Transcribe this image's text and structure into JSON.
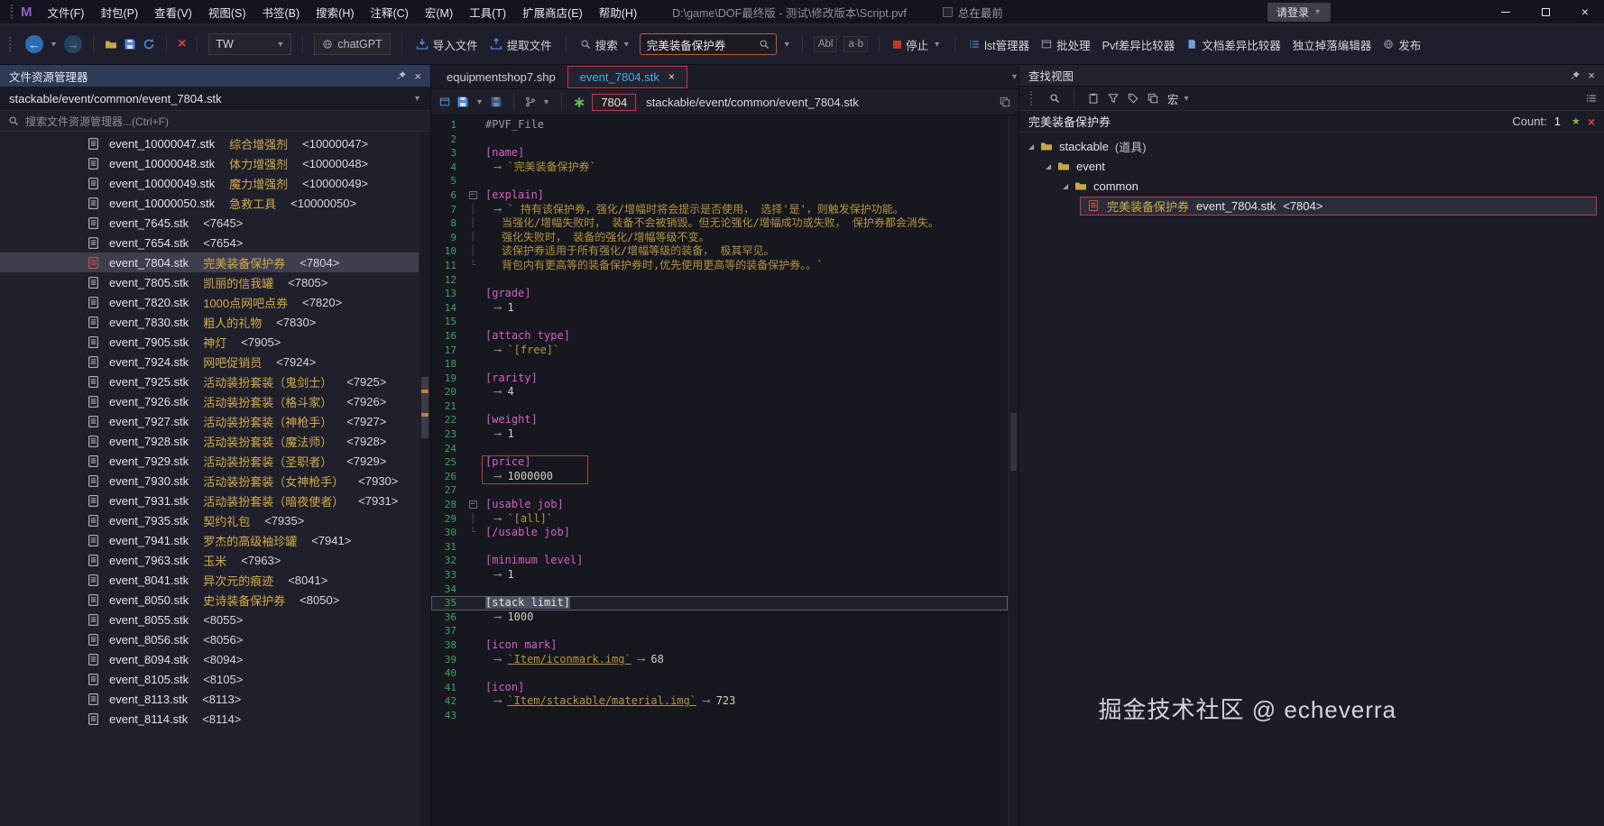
{
  "icons": {
    "back": "←",
    "forward": "→",
    "close": "×",
    "dropdown": "▾",
    "star": "∗",
    "sparkle": "★",
    "expand": "◢",
    "fold_collapse": "−",
    "guide_mid": "│",
    "guide_end": "└"
  },
  "titlebar": {
    "logo": "M",
    "menus": [
      "文件(F)",
      "封包(P)",
      "查看(V)",
      "视图(S)",
      "书签(B)",
      "搜索(H)",
      "注释(C)",
      "宏(M)",
      "工具(T)",
      "扩展商店(E)",
      "帮助(H)"
    ],
    "file_path": "D:\\game\\DOF最终版 - 测试\\修改版本\\Script.pvf",
    "always_on_top": "总在最前",
    "login": "请登录"
  },
  "toolbar": {
    "language": "TW",
    "chatgpt": "chatGPT",
    "import_file": "导入文件",
    "extract_file": "提取文件",
    "search_menu": "搜索",
    "search_value": "完美装备保护券",
    "match_case": "Abl",
    "match_word": "a·b",
    "stop": "停止",
    "lst_manager": "lst管理器",
    "batch": "批处理",
    "pvf_diff": "Pvf差异比较器",
    "doc_diff": "文档差异比较器",
    "drop_editor": "独立掉落编辑器",
    "publish": "发布"
  },
  "explorer": {
    "title": "文件资源管理器",
    "path": "stackable/event/common/event_7804.stk",
    "search_placeholder": "搜索文件资源管理器...(Ctrl+F)",
    "files": [
      {
        "name": "event_10000047.stk",
        "desc": "综合增强剂",
        "id": "<10000047>"
      },
      {
        "name": "event_10000048.stk",
        "desc": "体力增强剂",
        "id": "<10000048>"
      },
      {
        "name": "event_10000049.stk",
        "desc": "魔力增强剂",
        "id": "<10000049>"
      },
      {
        "name": "event_10000050.stk",
        "desc": "急救工具",
        "id": "<10000050>"
      },
      {
        "name": "event_7645.stk",
        "desc": "",
        "id": "<7645>"
      },
      {
        "name": "event_7654.stk",
        "desc": "",
        "id": "<7654>"
      },
      {
        "name": "event_7804.stk",
        "desc": "完美装备保护券",
        "id": "<7804>",
        "selected": true
      },
      {
        "name": "event_7805.stk",
        "desc": "凯丽的信我罐",
        "id": "<7805>"
      },
      {
        "name": "event_7820.stk",
        "desc": "1000点网吧点券",
        "id": "<7820>"
      },
      {
        "name": "event_7830.stk",
        "desc": "粗人的礼物",
        "id": "<7830>"
      },
      {
        "name": "event_7905.stk",
        "desc": "神灯",
        "id": "<7905>"
      },
      {
        "name": "event_7924.stk",
        "desc": "网吧促销员",
        "id": "<7924>"
      },
      {
        "name": "event_7925.stk",
        "desc": "活动装扮套装（鬼剑士）",
        "id": "<7925>"
      },
      {
        "name": "event_7926.stk",
        "desc": "活动装扮套装（格斗家）",
        "id": "<7926>"
      },
      {
        "name": "event_7927.stk",
        "desc": "活动装扮套装（神枪手）",
        "id": "<7927>"
      },
      {
        "name": "event_7928.stk",
        "desc": "活动装扮套装（魔法师）",
        "id": "<7928>"
      },
      {
        "name": "event_7929.stk",
        "desc": "活动装扮套装（圣职者）",
        "id": "<7929>"
      },
      {
        "name": "event_7930.stk",
        "desc": "活动装扮套装（女神枪手）",
        "id": "<7930>"
      },
      {
        "name": "event_7931.stk",
        "desc": "活动装扮套装（暗夜使者）",
        "id": "<7931>"
      },
      {
        "name": "event_7935.stk",
        "desc": "契约礼包",
        "id": "<7935>"
      },
      {
        "name": "event_7941.stk",
        "desc": "罗杰的高级袖珍罐",
        "id": "<7941>"
      },
      {
        "name": "event_7963.stk",
        "desc": "玉米",
        "id": "<7963>"
      },
      {
        "name": "event_8041.stk",
        "desc": "异次元的痕迹",
        "id": "<8041>"
      },
      {
        "name": "event_8050.stk",
        "desc": "史诗装备保护券",
        "id": "<8050>"
      },
      {
        "name": "event_8055.stk",
        "desc": "",
        "id": "<8055>"
      },
      {
        "name": "event_8056.stk",
        "desc": "",
        "id": "<8056>"
      },
      {
        "name": "event_8094.stk",
        "desc": "",
        "id": "<8094>"
      },
      {
        "name": "event_8105.stk",
        "desc": "",
        "id": "<8105>"
      },
      {
        "name": "event_8113.stk",
        "desc": "",
        "id": "<8113>"
      },
      {
        "name": "event_8114.stk",
        "desc": "",
        "id": "<8114>"
      }
    ]
  },
  "editor": {
    "tabs": [
      {
        "label": "equipmentshop7.shp",
        "active": false
      },
      {
        "label": "event_7804.stk",
        "active": true
      }
    ],
    "locate_id": "7804",
    "path": "stackable/event/common/event_7804.stk",
    "lines": [
      {
        "n": 1,
        "segs": [
          {
            "c": "cmt",
            "t": "#PVF_File"
          }
        ]
      },
      {
        "n": 2,
        "segs": []
      },
      {
        "n": 3,
        "segs": [
          {
            "c": "tag",
            "t": "[name]"
          }
        ]
      },
      {
        "n": 4,
        "ind": 1,
        "segs": [
          {
            "c": "arr",
            "t": "⟶ "
          },
          {
            "c": "str",
            "t": "`完美装备保护券`"
          }
        ]
      },
      {
        "n": 5,
        "segs": []
      },
      {
        "n": 6,
        "fold": true,
        "segs": [
          {
            "c": "tag",
            "t": "[explain]"
          }
        ]
      },
      {
        "n": 7,
        "guide": "mid",
        "ind": 1,
        "segs": [
          {
            "c": "arr",
            "t": "⟶ "
          },
          {
            "c": "str",
            "t": "` 持有该保护券，强化/增幅时将会提示是否使用， 选择'是'，则触发保护功能。"
          }
        ]
      },
      {
        "n": 8,
        "guide": "mid",
        "ind": 2,
        "segs": [
          {
            "c": "str",
            "t": "当强化/增幅失败时， 装备不会被销毁。但无论强化/增幅成功或失败， 保护券都会消失。"
          }
        ]
      },
      {
        "n": 9,
        "guide": "mid",
        "ind": 2,
        "segs": [
          {
            "c": "str",
            "t": "强化失败时， 装备的强化/增幅等级不变。"
          }
        ]
      },
      {
        "n": 10,
        "guide": "mid",
        "ind": 2,
        "segs": [
          {
            "c": "str",
            "t": "该保护券适用于所有强化/增幅等级的装备， 极其罕见。"
          }
        ]
      },
      {
        "n": 11,
        "guide": "end",
        "ind": 2,
        "segs": [
          {
            "c": "str",
            "t": "背包内有更高等的装备保护券时,优先使用更高等的装备保护券。。`"
          }
        ]
      },
      {
        "n": 12,
        "segs": []
      },
      {
        "n": 13,
        "segs": [
          {
            "c": "tag",
            "t": "[grade]"
          }
        ]
      },
      {
        "n": 14,
        "ind": 1,
        "segs": [
          {
            "c": "arr",
            "t": "⟶ "
          },
          {
            "c": "num",
            "t": "1"
          }
        ]
      },
      {
        "n": 15,
        "segs": []
      },
      {
        "n": 16,
        "segs": [
          {
            "c": "tag",
            "t": "[attach type]"
          }
        ]
      },
      {
        "n": 17,
        "ind": 1,
        "segs": [
          {
            "c": "arr",
            "t": "⟶ "
          },
          {
            "c": "str",
            "t": "`[free]`"
          }
        ]
      },
      {
        "n": 18,
        "segs": []
      },
      {
        "n": 19,
        "segs": [
          {
            "c": "tag",
            "t": "[rarity]"
          }
        ]
      },
      {
        "n": 20,
        "ind": 1,
        "segs": [
          {
            "c": "arr",
            "t": "⟶ "
          },
          {
            "c": "num",
            "t": "4"
          }
        ]
      },
      {
        "n": 21,
        "segs": []
      },
      {
        "n": 22,
        "segs": [
          {
            "c": "tag",
            "t": "[weight]"
          }
        ]
      },
      {
        "n": 23,
        "ind": 1,
        "segs": [
          {
            "c": "arr",
            "t": "⟶ "
          },
          {
            "c": "num",
            "t": "1"
          }
        ]
      },
      {
        "n": 24,
        "segs": []
      },
      {
        "n": 25,
        "segs": [
          {
            "c": "tag",
            "t": "[price]"
          }
        ]
      },
      {
        "n": 26,
        "ind": 1,
        "segs": [
          {
            "c": "arr",
            "t": "⟶ "
          },
          {
            "c": "num",
            "t": "1000000"
          }
        ]
      },
      {
        "n": 27,
        "segs": []
      },
      {
        "n": 28,
        "fold": true,
        "segs": [
          {
            "c": "tag",
            "t": "[usable job]"
          }
        ]
      },
      {
        "n": 29,
        "guide": "mid",
        "ind": 1,
        "segs": [
          {
            "c": "arr",
            "t": "⟶ "
          },
          {
            "c": "str",
            "t": "`[all]`"
          }
        ]
      },
      {
        "n": 30,
        "guide": "end",
        "segs": [
          {
            "c": "tag",
            "t": "[/usable job]"
          }
        ]
      },
      {
        "n": 31,
        "segs": []
      },
      {
        "n": 32,
        "segs": [
          {
            "c": "tag",
            "t": "[minimum level]"
          }
        ]
      },
      {
        "n": 33,
        "ind": 1,
        "segs": [
          {
            "c": "arr",
            "t": "⟶ "
          },
          {
            "c": "num",
            "t": "1"
          }
        ]
      },
      {
        "n": 34,
        "segs": []
      },
      {
        "n": 35,
        "current": true,
        "segs": [
          {
            "c": "tag",
            "t": "[stack limit]",
            "sel": true
          }
        ]
      },
      {
        "n": 36,
        "ind": 1,
        "segs": [
          {
            "c": "arr",
            "t": "⟶ "
          },
          {
            "c": "num",
            "t": "1000"
          }
        ]
      },
      {
        "n": 37,
        "segs": []
      },
      {
        "n": 38,
        "segs": [
          {
            "c": "tag",
            "t": "[icon mark]"
          }
        ]
      },
      {
        "n": 39,
        "ind": 1,
        "segs": [
          {
            "c": "arr",
            "t": "⟶ "
          },
          {
            "c": "link",
            "t": "`Item/iconmark.img`"
          },
          {
            "c": "arr",
            "t": " ⟶ "
          },
          {
            "c": "num",
            "t": "68"
          }
        ]
      },
      {
        "n": 40,
        "segs": []
      },
      {
        "n": 41,
        "segs": [
          {
            "c": "tag",
            "t": "[icon]"
          }
        ]
      },
      {
        "n": 42,
        "ind": 1,
        "segs": [
          {
            "c": "arr",
            "t": "⟶ "
          },
          {
            "c": "link",
            "t": "`Item/stackable/material.img`"
          },
          {
            "c": "arr",
            "t": " ⟶ "
          },
          {
            "c": "num",
            "t": "723"
          }
        ]
      },
      {
        "n": 43,
        "segs": []
      }
    ]
  },
  "find_view": {
    "title": "查找视图",
    "macro": "宏",
    "query": "完美装备保护券",
    "count_label": "Count:",
    "count_value": "1",
    "tree": [
      {
        "level": 0,
        "folder": true,
        "label": "stackable",
        "suffix": "(道具)"
      },
      {
        "level": 1,
        "folder": true,
        "label": "event"
      },
      {
        "level": 2,
        "folder": true,
        "label": "common"
      },
      {
        "level": 3,
        "folder": false,
        "gold": "完美装备保护券",
        "label": "event_7804.stk",
        "id": "<7804>",
        "highlight": true
      }
    ]
  },
  "watermark": "掘金技术社区 @ echeverra"
}
